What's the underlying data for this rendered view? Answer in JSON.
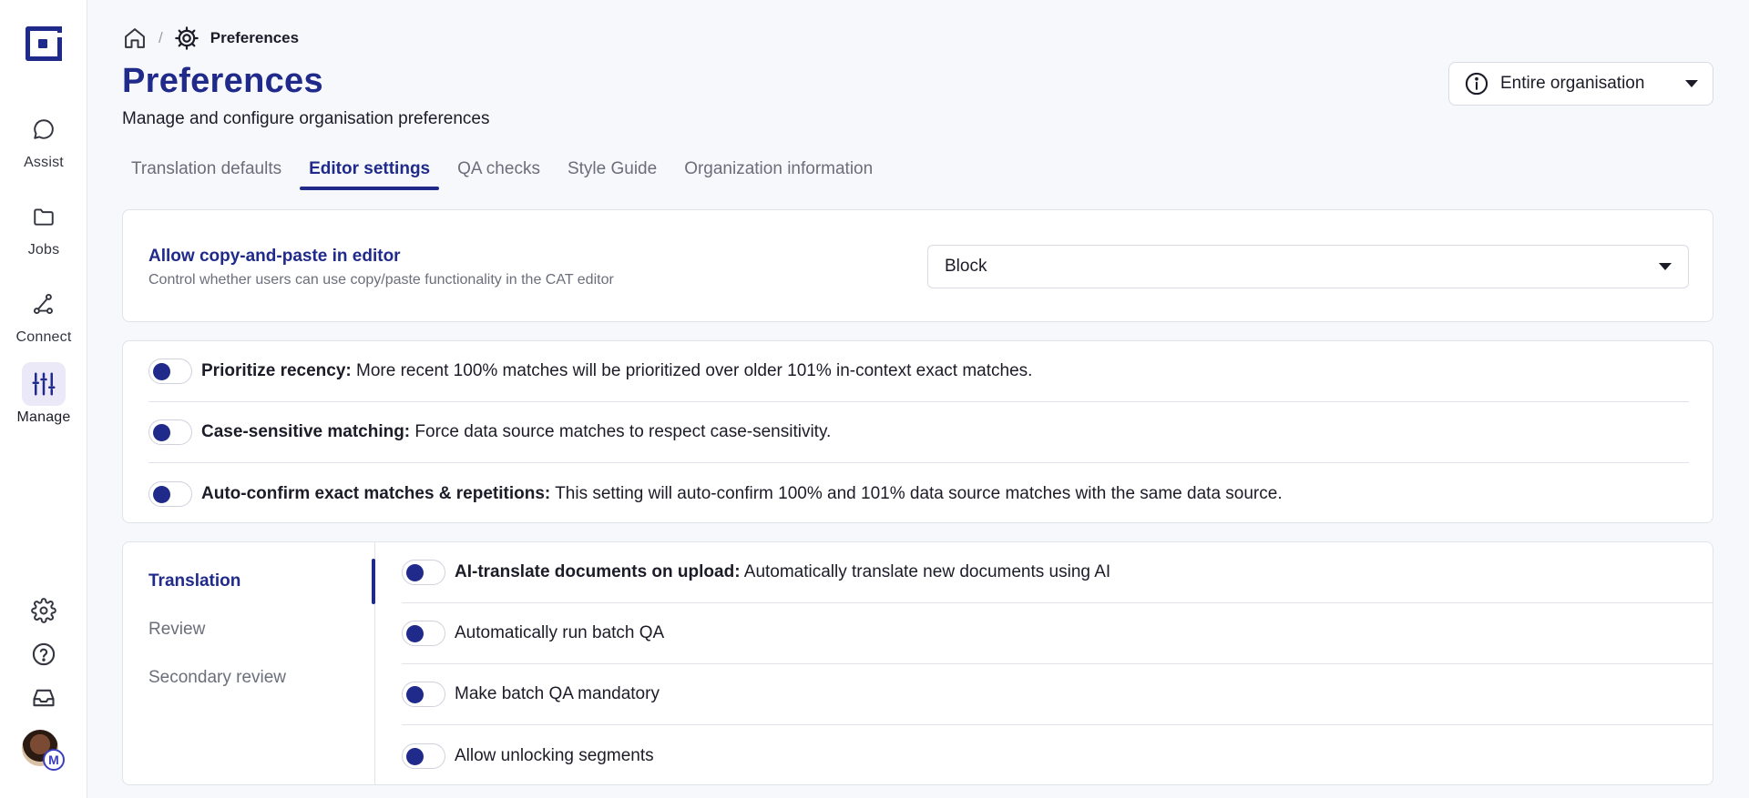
{
  "sidebar": {
    "items": [
      {
        "label": "Assist",
        "icon": "chat-bubble-icon"
      },
      {
        "label": "Jobs",
        "icon": "folder-icon"
      },
      {
        "label": "Connect",
        "icon": "connect-nodes-icon"
      },
      {
        "label": "Manage",
        "icon": "sliders-icon",
        "active": true
      }
    ],
    "avatar_badge": "M"
  },
  "breadcrumb": {
    "current": "Preferences",
    "separator": "/"
  },
  "page": {
    "title": "Preferences",
    "subtitle": "Manage and configure organisation preferences"
  },
  "scope_selector": {
    "value": "Entire organisation"
  },
  "tabs": [
    {
      "label": "Translation defaults"
    },
    {
      "label": "Editor settings",
      "active": true
    },
    {
      "label": "QA checks"
    },
    {
      "label": "Style Guide"
    },
    {
      "label": "Organization information"
    }
  ],
  "copy_paste": {
    "title": "Allow copy-and-paste in editor",
    "description": "Control whether users can use copy/paste functionality in the CAT editor",
    "value": "Block"
  },
  "matching_settings": [
    {
      "label": "Prioritize recency:",
      "text": "More recent 100% matches will be prioritized over older 101% in-context exact matches."
    },
    {
      "label": "Case-sensitive matching:",
      "text": "Force data source matches to respect case-sensitivity."
    },
    {
      "label": "Auto-confirm exact matches & repetitions:",
      "text": "This setting will auto-confirm 100% and 101% data source matches with the same data source."
    }
  ],
  "workflow": {
    "subnav": [
      {
        "label": "Translation",
        "active": true
      },
      {
        "label": "Review"
      },
      {
        "label": "Secondary review"
      }
    ],
    "settings": [
      {
        "label": "AI-translate documents on upload:",
        "text": "Automatically translate new documents using AI"
      },
      {
        "label": "",
        "text": "Automatically run batch QA"
      },
      {
        "label": "",
        "text": "Make batch QA mandatory"
      },
      {
        "label": "",
        "text": "Allow unlocking segments"
      }
    ]
  },
  "colors": {
    "accent": "#1f2a8a",
    "muted": "#6b6e7b"
  }
}
